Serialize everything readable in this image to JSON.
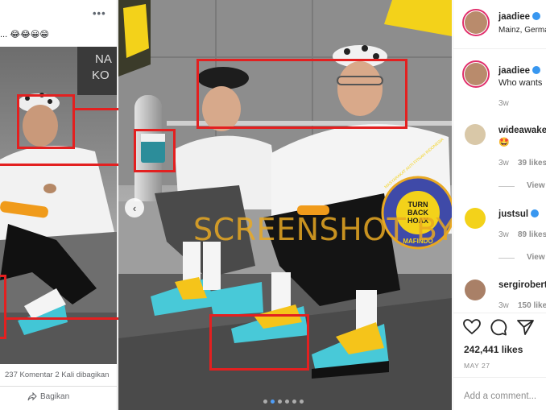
{
  "facebook": {
    "menu": "•••",
    "caption": "... 😂😂😀😁",
    "stats_comments": "237 Komentar",
    "stats_shares": "2 Kali dibagikan",
    "share_label": "Bagikan"
  },
  "photo": {
    "watermark": "SCREENSHOT BY",
    "badge_text_top": "TURN",
    "badge_text_mid": "BACK",
    "badge_text_bot": "HOAX",
    "badge_ring": "MASYARAKAT ANTI FITNAH INDONESIA",
    "badge_org": "MAFINDO",
    "wall_sign": "NA KO",
    "carousel_total": 6,
    "carousel_active": 1
  },
  "instagram": {
    "header_user": "jaadiee",
    "header_location": "Mainz, Germa",
    "caption_user": "jaadiee",
    "caption_text": "Who wants",
    "caption_time": "3w",
    "comments": [
      {
        "user": "wideawake",
        "text": "🤩",
        "time": "3w",
        "likes": "39 likes",
        "view": "View"
      },
      {
        "user": "justsul",
        "text": "",
        "time": "3w",
        "likes": "89 likes",
        "view": "View"
      },
      {
        "user": "sergirobert",
        "text": "",
        "time": "3w",
        "likes": "150 likes",
        "view": ""
      }
    ],
    "likes_count": "242,441 likes",
    "post_date": "MAY 27",
    "add_comment_placeholder": "Add a comment..."
  },
  "colors": {
    "highlight": "#e32020",
    "verified": "#3897f0",
    "watermark": "#e8a822",
    "badge": "#3f4aa8"
  }
}
